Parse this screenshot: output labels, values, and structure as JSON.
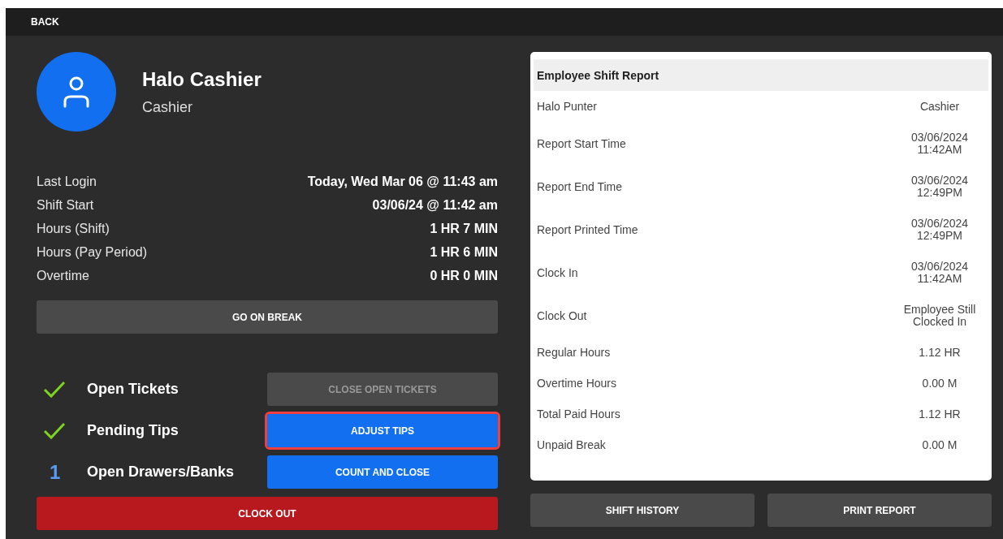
{
  "top_bar": {
    "back": "BACK"
  },
  "profile": {
    "name": "Halo Cashier",
    "role": "Cashier"
  },
  "stats": [
    {
      "label": "Last Login",
      "value": "Today, Wed Mar 06 @ 11:43 am"
    },
    {
      "label": "Shift Start",
      "value": "03/06/24 @ 11:42 am"
    },
    {
      "label": "Hours (Shift)",
      "value": "1 HR 7 MIN"
    },
    {
      "label": "Hours (Pay Period)",
      "value": "1 HR 6 MIN"
    },
    {
      "label": "Overtime",
      "value": "0 HR 0 MIN"
    }
  ],
  "break_button": "GO ON BREAK",
  "tasks": [
    {
      "kind": "check",
      "label": "Open Tickets",
      "button": "CLOSE OPEN TICKETS",
      "disabled": true,
      "highlighted": false
    },
    {
      "kind": "check",
      "label": "Pending Tips",
      "button": "ADJUST TIPS",
      "disabled": false,
      "highlighted": true
    },
    {
      "kind": "count",
      "count": "1",
      "label": "Open Drawers/Banks",
      "button": "COUNT AND CLOSE",
      "disabled": false,
      "highlighted": false
    }
  ],
  "clock_out": "CLOCK OUT",
  "report": {
    "title": "Employee Shift Report",
    "rows": [
      {
        "label": "Halo Punter",
        "value": [
          "Cashier"
        ]
      },
      {
        "label": "Report Start Time",
        "value": [
          "03/06/2024",
          "11:42AM"
        ]
      },
      {
        "label": "Report End Time",
        "value": [
          "03/06/2024",
          "12:49PM"
        ]
      },
      {
        "label": "Report Printed Time",
        "value": [
          "03/06/2024",
          "12:49PM"
        ]
      },
      {
        "label": "Clock In",
        "value": [
          "03/06/2024",
          "11:42AM"
        ]
      },
      {
        "label": "Clock Out",
        "value": [
          "Employee Still",
          "Clocked In"
        ]
      },
      {
        "label": "Regular Hours",
        "value": [
          "1.12 HR"
        ]
      },
      {
        "label": "Overtime Hours",
        "value": [
          "0.00 M"
        ]
      },
      {
        "label": "Total Paid Hours",
        "value": [
          "1.12 HR"
        ]
      },
      {
        "label": "Unpaid Break",
        "value": [
          "0.00 M"
        ]
      }
    ]
  },
  "report_buttons": [
    "SHIFT HISTORY",
    "PRINT REPORT"
  ]
}
